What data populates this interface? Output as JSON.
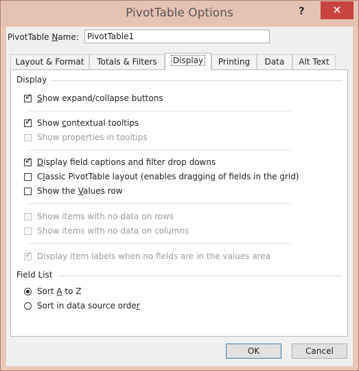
{
  "window": {
    "title": "PivotTable Options",
    "help_glyph": "?",
    "close_glyph": "✕",
    "accent": "#c7433f"
  },
  "name_field": {
    "label": "PivotTable Name:",
    "value": "PivotTable1"
  },
  "tabs": [
    {
      "label": "Layout & Format"
    },
    {
      "label": "Totals & Filters"
    },
    {
      "label": "Display",
      "active": true
    },
    {
      "label": "Printing"
    },
    {
      "label": "Data"
    },
    {
      "label": "Alt Text"
    }
  ],
  "display_section": {
    "title": "Display",
    "options": [
      {
        "label": "Show expand/collapse buttons",
        "checked": true,
        "enabled": true
      },
      {
        "label": "Show contextual tooltips",
        "checked": true,
        "enabled": true
      },
      {
        "label": "Show properties in tooltips",
        "checked": false,
        "enabled": false
      },
      {
        "label": "Display field captions and filter drop downs",
        "checked": true,
        "enabled": true
      },
      {
        "label": "Classic PivotTable layout (enables dragging of fields in the grid)",
        "checked": false,
        "enabled": true
      },
      {
        "label": "Show the Values row",
        "checked": false,
        "enabled": true
      },
      {
        "label": "Show items with no data on rows",
        "checked": false,
        "enabled": false
      },
      {
        "label": "Show items with no data on columns",
        "checked": false,
        "enabled": false
      },
      {
        "label": "Display item labels when no fields are in the values area",
        "checked": true,
        "enabled": false
      }
    ]
  },
  "field_list_section": {
    "title": "Field List",
    "options": [
      {
        "label": "Sort A to Z",
        "selected": true
      },
      {
        "label": "Sort in data source order",
        "selected": false
      }
    ]
  },
  "buttons": {
    "ok": "OK",
    "cancel": "Cancel"
  }
}
